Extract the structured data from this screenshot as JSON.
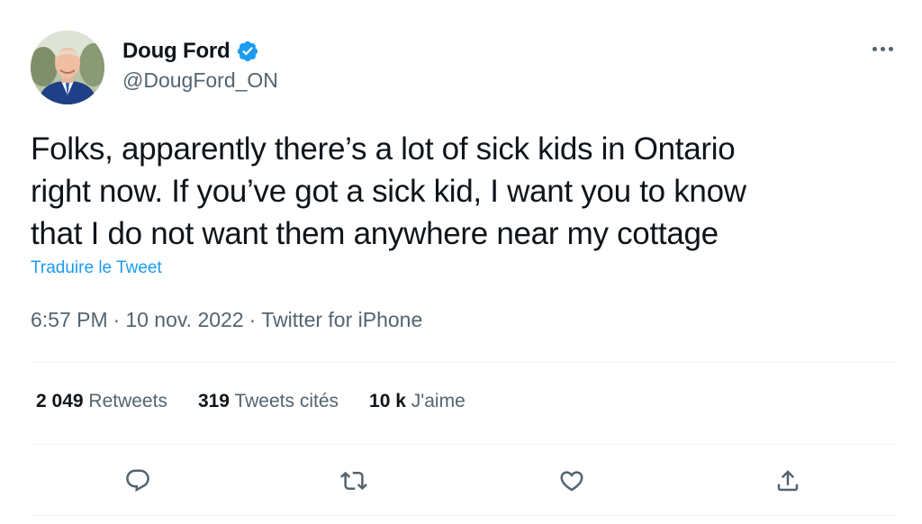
{
  "author": {
    "display_name": "Doug Ford",
    "handle": "@DougFord_ON",
    "verified": true,
    "avatar_icon": "profile-photo"
  },
  "tweet": {
    "text": "Folks, apparently there’s a lot of sick kids in Ontario\nright now. If you’ve got a sick kid, I want you to know\nthat I do not want them anywhere near my cottage",
    "translate_label": "Traduire le Tweet",
    "time": "6:57 PM",
    "separator": "·",
    "date": "10 nov. 2022",
    "source": "Twitter for iPhone"
  },
  "stats": {
    "retweets_count": "2 049",
    "retweets_label": "Retweets",
    "quotes_count": "319",
    "quotes_label": "Tweets cités",
    "likes_count": "10 k",
    "likes_label": "J'aime"
  },
  "actions": {
    "reply_icon": "reply-icon",
    "retweet_icon": "retweet-icon",
    "like_icon": "heart-icon",
    "share_icon": "share-icon",
    "more_icon": "more-icon"
  },
  "colors": {
    "accent": "#1d9bf0",
    "text_primary": "#0f1419",
    "text_secondary": "#536471",
    "divider": "#eff3f4"
  }
}
